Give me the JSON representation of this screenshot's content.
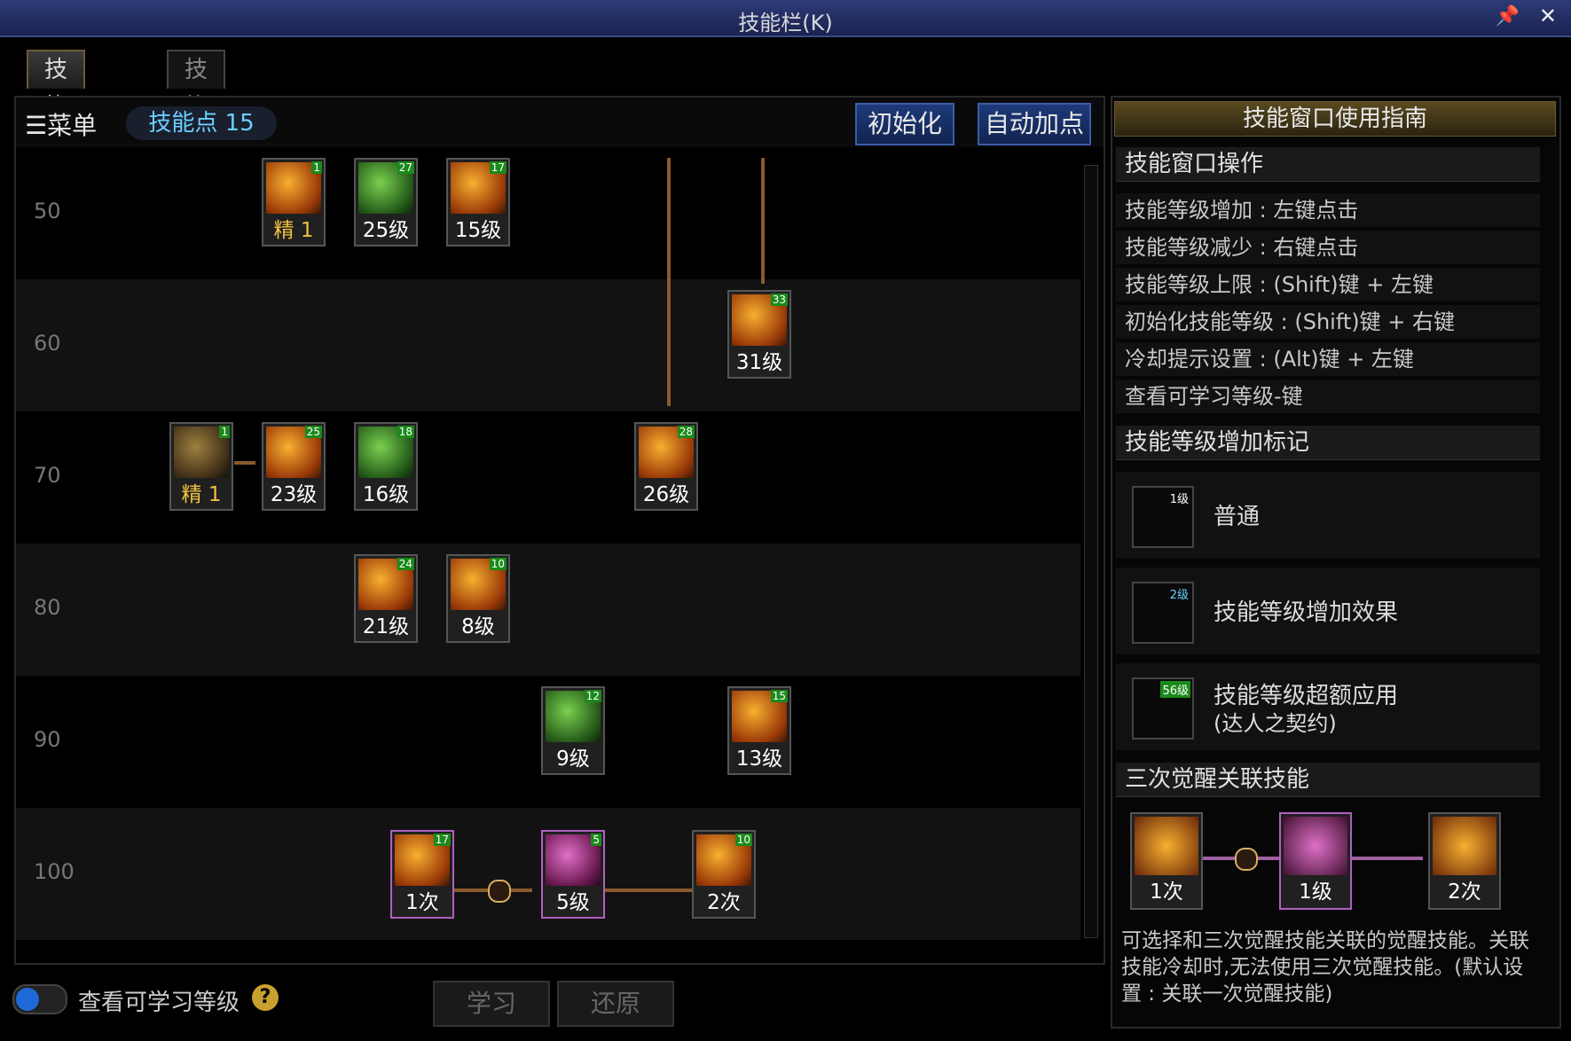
{
  "window": {
    "title": "技能栏(K)",
    "pin_icon": "pin-icon",
    "close_icon": "close-icon"
  },
  "tabs": [
    {
      "label": "技能类型 I",
      "active": true
    },
    {
      "label": "技能类型 II",
      "active": false
    }
  ],
  "toolbar": {
    "menu_label": "☰菜单",
    "skill_points_label": "技能点",
    "skill_points_value": "15",
    "reset_label": "初始化",
    "auto_label": "自动加点"
  },
  "rows": [
    {
      "level": "50"
    },
    {
      "level": "60"
    },
    {
      "level": "70"
    },
    {
      "level": "80"
    },
    {
      "level": "90"
    },
    {
      "level": "100"
    }
  ],
  "skills": [
    {
      "label": "精  1",
      "count": "1",
      "color": "orange",
      "yellow": true
    },
    {
      "label": "25级",
      "count": "27",
      "color": "green"
    },
    {
      "label": "15级",
      "count": "17",
      "color": "orange"
    },
    {
      "label": "31级",
      "count": "33",
      "color": "orange"
    },
    {
      "label": "精  1",
      "count": "1",
      "color": "dark",
      "yellow": true
    },
    {
      "label": "23级",
      "count": "25",
      "color": "orange"
    },
    {
      "label": "16级",
      "count": "18",
      "color": "green"
    },
    {
      "label": "26级",
      "count": "28",
      "color": "orange"
    },
    {
      "label": "21级",
      "count": "24",
      "color": "orange"
    },
    {
      "label": "8级",
      "count": "10",
      "color": "orange"
    },
    {
      "label": "9级",
      "count": "12",
      "color": "green"
    },
    {
      "label": "13级",
      "count": "15",
      "color": "orange"
    },
    {
      "label": "1次",
      "count": "17",
      "color": "orange"
    },
    {
      "label": "5级",
      "count": "5",
      "color": "pink"
    },
    {
      "label": "2次",
      "count": "10",
      "color": "orange"
    }
  ],
  "bottom": {
    "toggle_label": "查看可学习等级",
    "help": "?",
    "learn_label": "学习",
    "revert_label": "还原"
  },
  "guide": {
    "title": "技能窗口使用指南",
    "section1": "技能窗口操作",
    "ops": [
      "技能等级增加 : 左键点击",
      "技能等级减少 : 右键点击",
      "技能等级上限 : (Shift)键 + 左键",
      "初始化技能等级 : (Shift)键 + 右键",
      "冷却提示设置 : (Alt)键 + 左键",
      "查看可学习等级-键"
    ],
    "section2": "技能等级增加标记",
    "marks": [
      {
        "tag": "1级",
        "text": "普通"
      },
      {
        "tag": "2级",
        "text": "技能等级增加效果"
      },
      {
        "tag": "56级",
        "text": "技能等级超额应用",
        "sub": "(达人之契约)"
      }
    ],
    "section3": "三次觉醒关联技能",
    "awaken": [
      "1次",
      "1级",
      "2次"
    ],
    "desc": "可选择和三次觉醒技能关联的觉醒技能。关联技能冷却时,无法使用三次觉醒技能。(默认设置 : 关联一次觉醒技能)"
  }
}
